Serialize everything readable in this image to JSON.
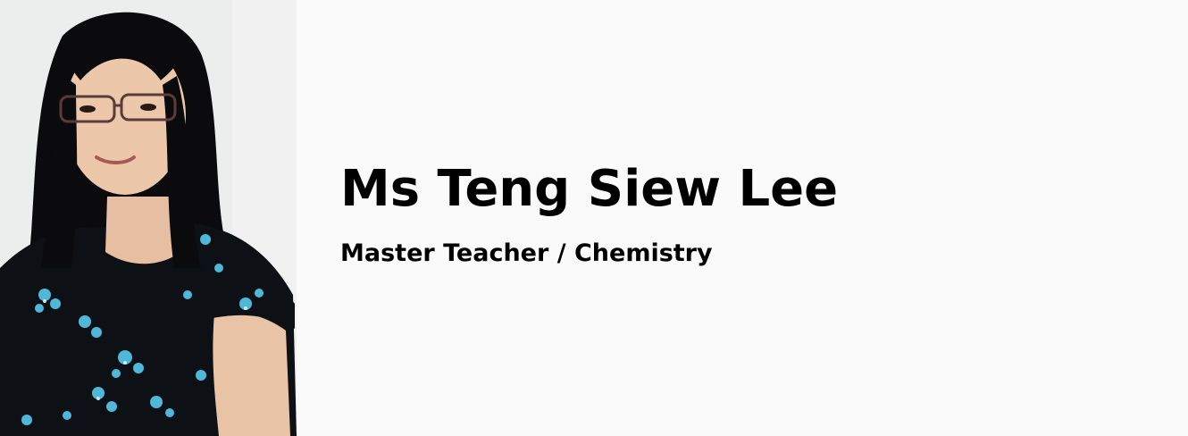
{
  "profile": {
    "name": "Ms Teng Siew Lee",
    "role": "Master Teacher / Chemistry"
  },
  "colors": {
    "background": "#fafafa",
    "text": "#000000",
    "blouse": "#0d1116",
    "flower_accent": "#4fb8d8",
    "hair": "#0b0b0d"
  },
  "icons": {
    "portrait": "person-photo"
  }
}
